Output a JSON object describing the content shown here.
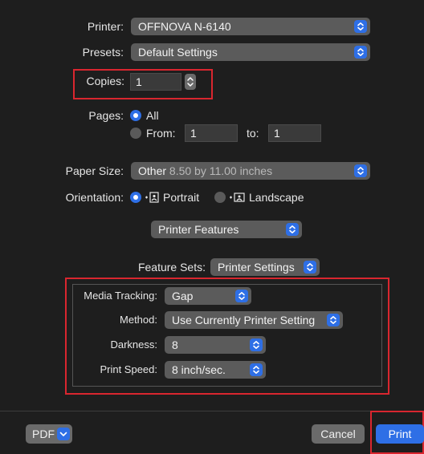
{
  "printer": {
    "label": "Printer:",
    "value": "OFFNOVA N-6140"
  },
  "presets": {
    "label": "Presets:",
    "value": "Default Settings"
  },
  "copies": {
    "label": "Copies:",
    "value": "1"
  },
  "pages": {
    "label": "Pages:",
    "all_label": "All",
    "from_label": "From:",
    "from_value": "1",
    "to_label": "to:",
    "to_value": "1",
    "selected": "All"
  },
  "paper_size": {
    "label": "Paper Size:",
    "value": "Other",
    "detail": "8.50 by 11.00 inches"
  },
  "orientation": {
    "label": "Orientation:",
    "portrait_label": "Portrait",
    "landscape_label": "Landscape",
    "selected": "Portrait"
  },
  "section_popup": {
    "value": "Printer Features"
  },
  "feature_sets": {
    "label": "Feature Sets:",
    "value": "Printer Settings"
  },
  "media_tracking": {
    "label": "Media Tracking:",
    "value": "Gap"
  },
  "method": {
    "label": "Method:",
    "value": "Use Currently Printer Setting"
  },
  "darkness": {
    "label": "Darkness:",
    "value": "8"
  },
  "print_speed": {
    "label": "Print Speed:",
    "value": "8 inch/sec."
  },
  "footer": {
    "pdf_label": "PDF",
    "cancel_label": "Cancel",
    "print_label": "Print"
  },
  "colors": {
    "accent": "#2e6fe6",
    "highlight": "#d9262f",
    "background": "#1e1e1e"
  }
}
